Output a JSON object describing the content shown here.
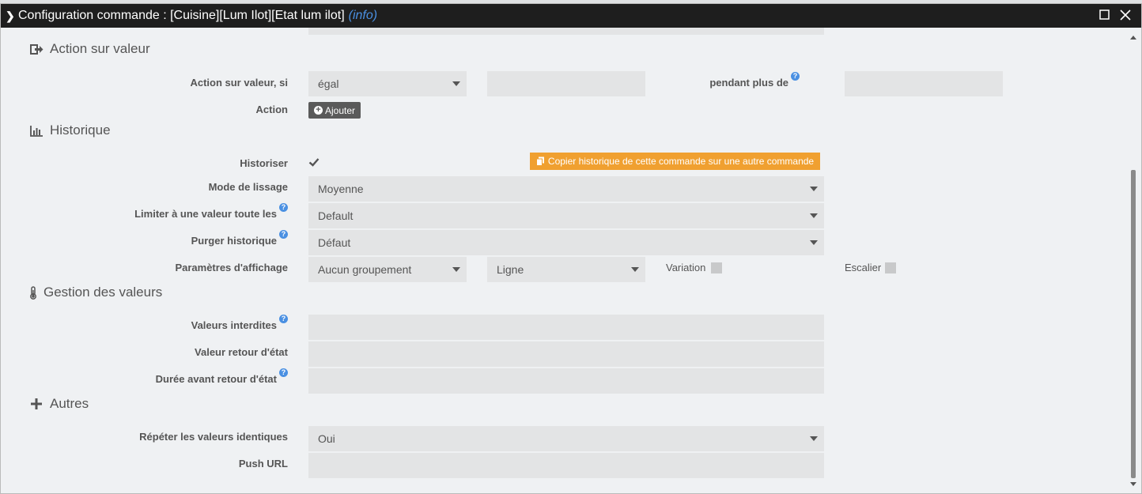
{
  "dialog": {
    "title": "Configuration commande : [Cuisine][Lum Ilot][Etat lum ilot]",
    "info": "(info)"
  },
  "sections": {
    "action": "Action sur valeur",
    "historique": "Historique",
    "gestion": "Gestion des valeurs",
    "autres": "Autres"
  },
  "action_sur_valeur": {
    "label_si": "Action sur valeur, si",
    "operator": "égal",
    "value": "",
    "label_pendant": "pendant plus de",
    "duration": "",
    "label_action": "Action",
    "add_button": "Ajouter"
  },
  "historique": {
    "label_historiser": "Historiser",
    "historiser_checked": true,
    "copy_button": "Copier historique de cette commande sur une autre commande",
    "label_lissage": "Mode de lissage",
    "lissage_value": "Moyenne",
    "label_limiter": "Limiter à une valeur toute les",
    "limiter_value": "Default",
    "label_purger": "Purger historique",
    "purger_value": "Défaut",
    "label_affichage": "Paramètres d'affichage",
    "groupement_value": "Aucun groupement",
    "type_value": "Ligne",
    "label_variation": "Variation",
    "label_escalier": "Escalier"
  },
  "gestion": {
    "label_interdites": "Valeurs interdites",
    "interdites_value": "",
    "label_retour": "Valeur retour d'état",
    "retour_value": "",
    "label_duree": "Durée avant retour d'état",
    "duree_value": ""
  },
  "autres": {
    "label_repeter": "Répéter les valeurs identiques",
    "repeter_value": "Oui",
    "label_push": "Push URL",
    "push_value": ""
  },
  "help_icon": "?",
  "colors": {
    "titlebar": "#1e1e1e",
    "info_link": "#4a90e2",
    "copy_button": "#f0a030",
    "add_button": "#5a5a5a",
    "field": "#e3e4e5"
  }
}
